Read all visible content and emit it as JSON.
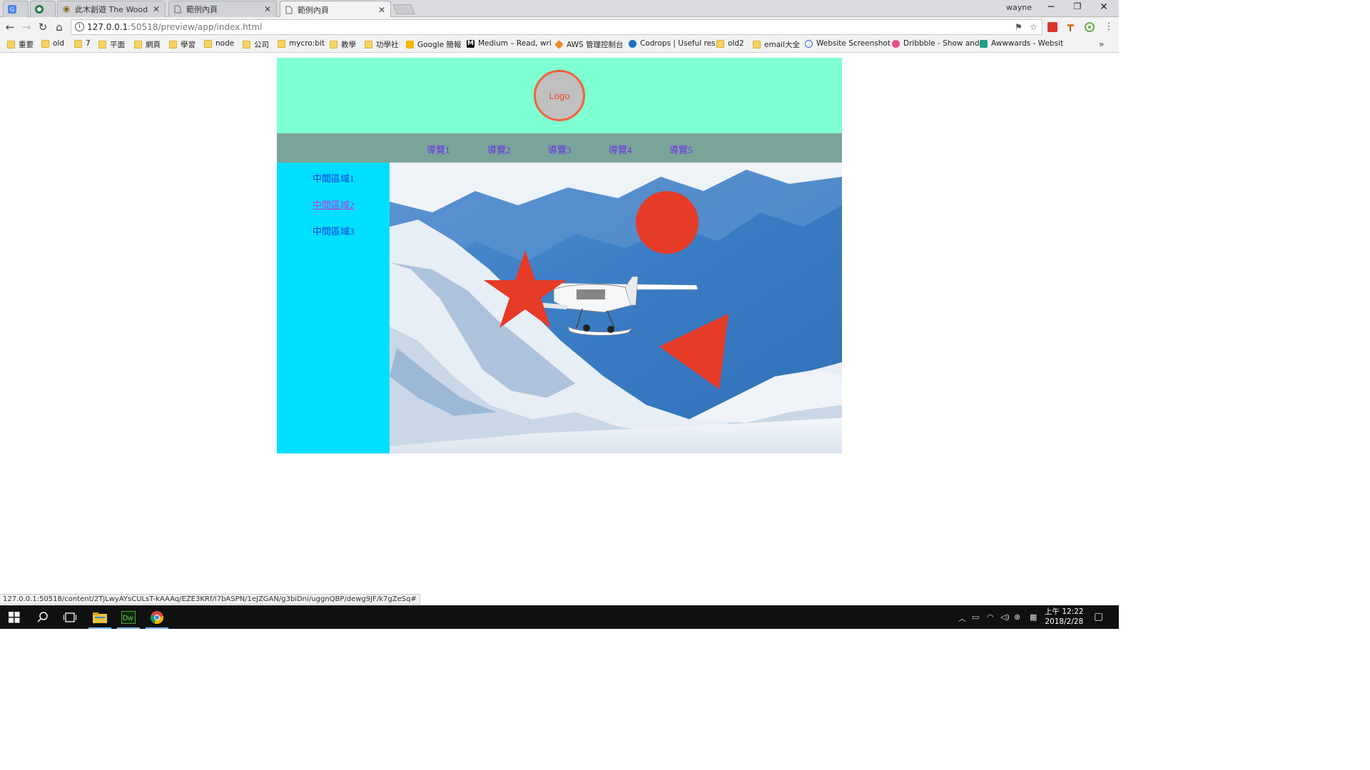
{
  "browser": {
    "tabs": [
      {
        "title": ""
      },
      {
        "title": ""
      },
      {
        "title": "此木創遊 The Wood Ga"
      },
      {
        "title": "範例內頁"
      },
      {
        "title": "範例內頁"
      }
    ],
    "profile": "wayne",
    "url_host": "127.0.0.1",
    "url_rest": ":50518/preview/app/index.html",
    "bookmarks": [
      {
        "label": "重要",
        "icon": "folder"
      },
      {
        "label": "old",
        "icon": "folder"
      },
      {
        "label": "7",
        "icon": "folder"
      },
      {
        "label": "平面",
        "icon": "folder"
      },
      {
        "label": "網頁",
        "icon": "folder"
      },
      {
        "label": "學習",
        "icon": "folder"
      },
      {
        "label": "node",
        "icon": "folder"
      },
      {
        "label": "公司",
        "icon": "folder"
      },
      {
        "label": "mycro:bit",
        "icon": "folder"
      },
      {
        "label": "教學",
        "icon": "folder"
      },
      {
        "label": "功學社",
        "icon": "folder"
      },
      {
        "label": "Google 簡報",
        "icon": "slides"
      },
      {
        "label": "Medium – Read, wri",
        "icon": "medium"
      },
      {
        "label": "AWS 管理控制台",
        "icon": "aws"
      },
      {
        "label": "Codrops | Useful res",
        "icon": "codrops"
      },
      {
        "label": "old2",
        "icon": "folder"
      },
      {
        "label": "email大全",
        "icon": "folder"
      },
      {
        "label": "Website Screenshot",
        "icon": "globe"
      },
      {
        "label": "Dribbble - Show and",
        "icon": "dribbble"
      },
      {
        "label": "Awwwards - Websit",
        "icon": "awwwards"
      }
    ],
    "status_url": "127.0.0.1:50518/content/2TjLwyAYsCULsT-kAAAq/EZE3KRf/I7bASPN/1eJZGAN/g3biDni/uggnQBP/dewg9JF/k7gZeSq#"
  },
  "page": {
    "logo": "Logo",
    "nav": [
      "導覽1",
      "導覽2",
      "導覽3",
      "導覽4",
      "導覽5"
    ],
    "side_links": [
      "中間區域1",
      "中間區域2",
      "中間區域3"
    ],
    "colors": {
      "header_bg": "#7fffd4",
      "nav_bg": "#7aa39a",
      "side_bg": "#00dfff",
      "shape_red": "#e63b26"
    }
  },
  "taskbar": {
    "clock_time": "上午 12:22",
    "clock_date": "2018/2/28"
  }
}
